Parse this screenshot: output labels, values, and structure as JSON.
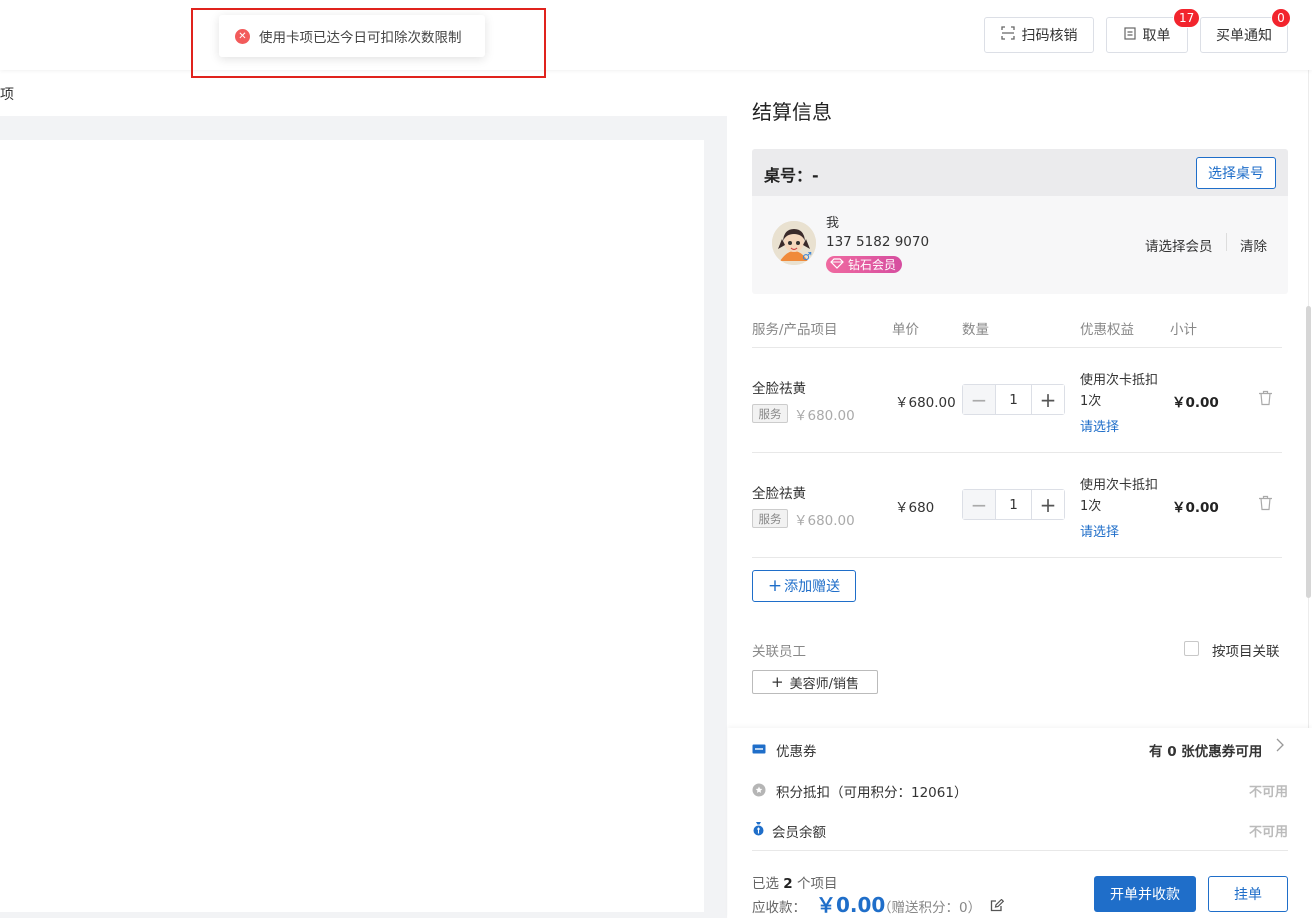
{
  "toast": {
    "message": "使用卡项已达今日可扣除次数限制",
    "icon": "error-circle-icon"
  },
  "topbar": {
    "scan_label": "扫码核销",
    "take_order_label": "取单",
    "take_order_badge": "17",
    "purchase_notice_label": "买单通知",
    "purchase_notice_badge": "0"
  },
  "left": {
    "tab_fragment": "项"
  },
  "settlement": {
    "title": "结算信息",
    "desk_label": "桌号：-",
    "choose_desk": "选择桌号",
    "member": {
      "name": "我",
      "phone": "137 5182 9070",
      "level": "钻石会员",
      "choose_member": "请选择会员",
      "clear": "清除"
    },
    "table": {
      "headers": [
        "服务/产品项目",
        "单价",
        "数量",
        "优惠权益",
        "小计"
      ],
      "rows": [
        {
          "name": "全脸祛黄",
          "tag": "服务",
          "orig_price": "￥680.00",
          "unit_price": "￥680.00",
          "qty": "1",
          "discount_line1": "使用次卡抵扣",
          "discount_line2": "1次",
          "discount_link": "请选择",
          "subtotal": "￥0.00"
        },
        {
          "name": "全脸祛黄",
          "tag": "服务",
          "orig_price": "￥680.00",
          "unit_price": "￥680",
          "qty": "1",
          "discount_line1": "使用次卡抵扣",
          "discount_line2": "1次",
          "discount_link": "请选择",
          "subtotal": "￥0.00"
        }
      ]
    },
    "add_gift": "添加赠送",
    "staff_label": "关联员工",
    "link_by_item": "按项目关联",
    "staff_button": "美容师/销售",
    "coupon": {
      "label": "优惠券",
      "right": "有 0 张优惠券可用"
    },
    "points": {
      "label": "积分抵扣（可用积分：12061）",
      "status": "不可用"
    },
    "balance": {
      "label": "会员余额",
      "status": "不可用"
    },
    "summary": {
      "selected_prefix": "已选",
      "selected_count": "2",
      "selected_suffix": "个项目",
      "due_label": "应收款：",
      "due_amount": "￥0.00",
      "gift_points": "（赠送积分：0）"
    },
    "pay_button": "开单并收款",
    "hold_button": "挂单"
  },
  "colors": {
    "primary": "#1f6ec9",
    "badge": "#f2242d",
    "error": "#f25b5b",
    "highlight_box": "#e0231d"
  }
}
